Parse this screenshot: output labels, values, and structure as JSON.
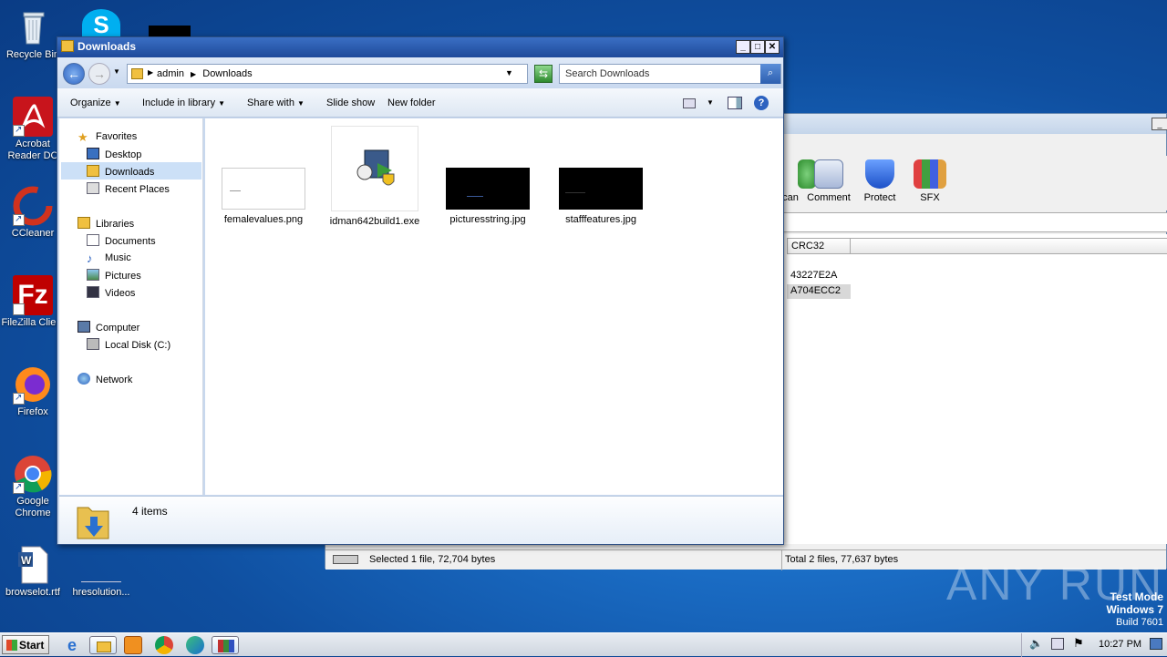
{
  "desktop": {
    "icons": [
      {
        "label": "Recycle Bin",
        "icon": "recycle-bin-icon"
      },
      {
        "label": "Acrobat Reader DC",
        "icon": "acrobat-icon"
      },
      {
        "label": "CCleaner",
        "icon": "ccleaner-icon"
      },
      {
        "label": "FileZilla Client",
        "icon": "filezilla-icon"
      },
      {
        "label": "Firefox",
        "icon": "firefox-icon"
      },
      {
        "label": "Google Chrome",
        "icon": "chrome-icon"
      },
      {
        "label": "browselot.rtf",
        "icon": "word-doc-icon"
      },
      {
        "label": "hresolution...",
        "icon": "file-icon"
      }
    ],
    "watermark": "ANY RUN",
    "os_info": {
      "line1": "Test Mode",
      "line2": "Windows 7",
      "line3": "Build 7601"
    }
  },
  "rar": {
    "tools": [
      {
        "label": "can"
      },
      {
        "label": "Comment"
      },
      {
        "label": "Protect"
      },
      {
        "label": "SFX"
      }
    ],
    "column": "CRC32",
    "rows": [
      "43227E2A",
      "A704ECC2"
    ],
    "status_left": "Selected 1 file, 72,704 bytes",
    "status_right": "Total 2 files, 77,637 bytes"
  },
  "explorer": {
    "title": "Downloads",
    "breadcrumb": [
      "admin",
      "Downloads"
    ],
    "search_placeholder": "Search Downloads",
    "commands": [
      "Organize",
      "Include in library",
      "Share with",
      "Slide show",
      "New folder"
    ],
    "nav": {
      "favorites": "Favorites",
      "desktop": "Desktop",
      "downloads": "Downloads",
      "recent": "Recent Places",
      "libraries": "Libraries",
      "documents": "Documents",
      "music": "Music",
      "pictures": "Pictures",
      "videos": "Videos",
      "computer": "Computer",
      "localdisk": "Local Disk (C:)",
      "network": "Network"
    },
    "files": [
      {
        "name": "femalevalues.png"
      },
      {
        "name": "idman642build1.exe"
      },
      {
        "name": "picturesstring.jpg"
      },
      {
        "name": "stafffeatures.jpg"
      }
    ],
    "item_count": "4 items"
  },
  "taskbar": {
    "start": "Start",
    "time": "10:27 PM"
  },
  "colors": {
    "accent": "#1e4a9a",
    "selection": "#cce0f7"
  }
}
